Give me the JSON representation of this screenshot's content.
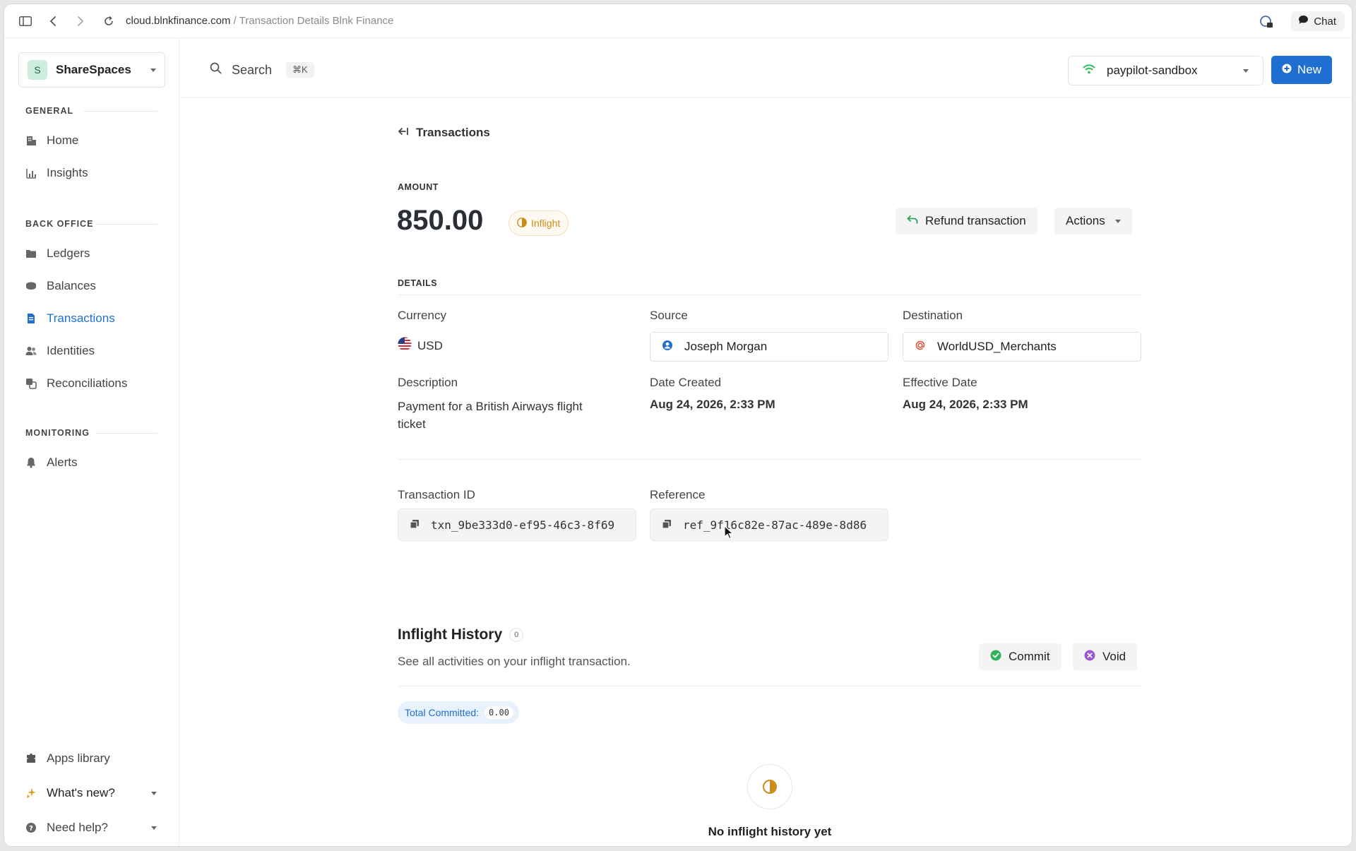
{
  "browser": {
    "domain": "cloud.blnkfinance.com",
    "separator": "/",
    "page_title": "Transaction Details Blnk Finance",
    "chat_label": "Chat"
  },
  "sidebar": {
    "workspace": {
      "initial": "S",
      "name": "ShareSpaces"
    },
    "sections": {
      "general": "GENERAL",
      "back_office": "BACK OFFICE",
      "monitoring": "MONITORING"
    },
    "items": {
      "home": "Home",
      "insights": "Insights",
      "ledgers": "Ledgers",
      "balances": "Balances",
      "transactions": "Transactions",
      "identities": "Identities",
      "reconciliations": "Reconciliations",
      "alerts": "Alerts",
      "apps_library": "Apps library",
      "whats_new": "What's new?",
      "need_help": "Need help?"
    },
    "active_color": "#1f6fd1"
  },
  "topbar": {
    "search_label": "Search",
    "search_shortcut": "⌘K",
    "environment": "paypilot-sandbox",
    "new_label": "New",
    "accent": "#1f6fd1"
  },
  "transaction": {
    "back_label": "Transactions",
    "amount_label": "AMOUNT",
    "amount": "850.00",
    "status": "Inflight",
    "status_color": "#cc8a19",
    "refund_label": "Refund transaction",
    "actions_label": "Actions",
    "details_label": "DETAILS",
    "currency_label": "Currency",
    "currency": "USD",
    "source_label": "Source",
    "source": "Joseph Morgan",
    "destination_label": "Destination",
    "destination": "WorldUSD_Merchants",
    "description_label": "Description",
    "description_line1": "Payment for a British Airways flight",
    "description_line2": "ticket",
    "date_created_label": "Date Created",
    "date_created": "Aug 24, 2026, 2:33 PM",
    "effective_date_label": "Effective Date",
    "effective_date": "Aug 24, 2026, 2:33 PM",
    "transaction_id_label": "Transaction ID",
    "transaction_id": "txn_9be333d0-ef95-46c3-8f69",
    "reference_label": "Reference",
    "reference": "ref_9f16c82e-87ac-489e-8d86"
  },
  "inflight": {
    "title": "Inflight History",
    "count": "0",
    "subtitle": "See all activities on your inflight transaction.",
    "commit_label": "Commit",
    "void_label": "Void",
    "total_committed_label": "Total Committed:",
    "total_committed_value": "0.00",
    "empty_text": "No inflight history yet"
  }
}
